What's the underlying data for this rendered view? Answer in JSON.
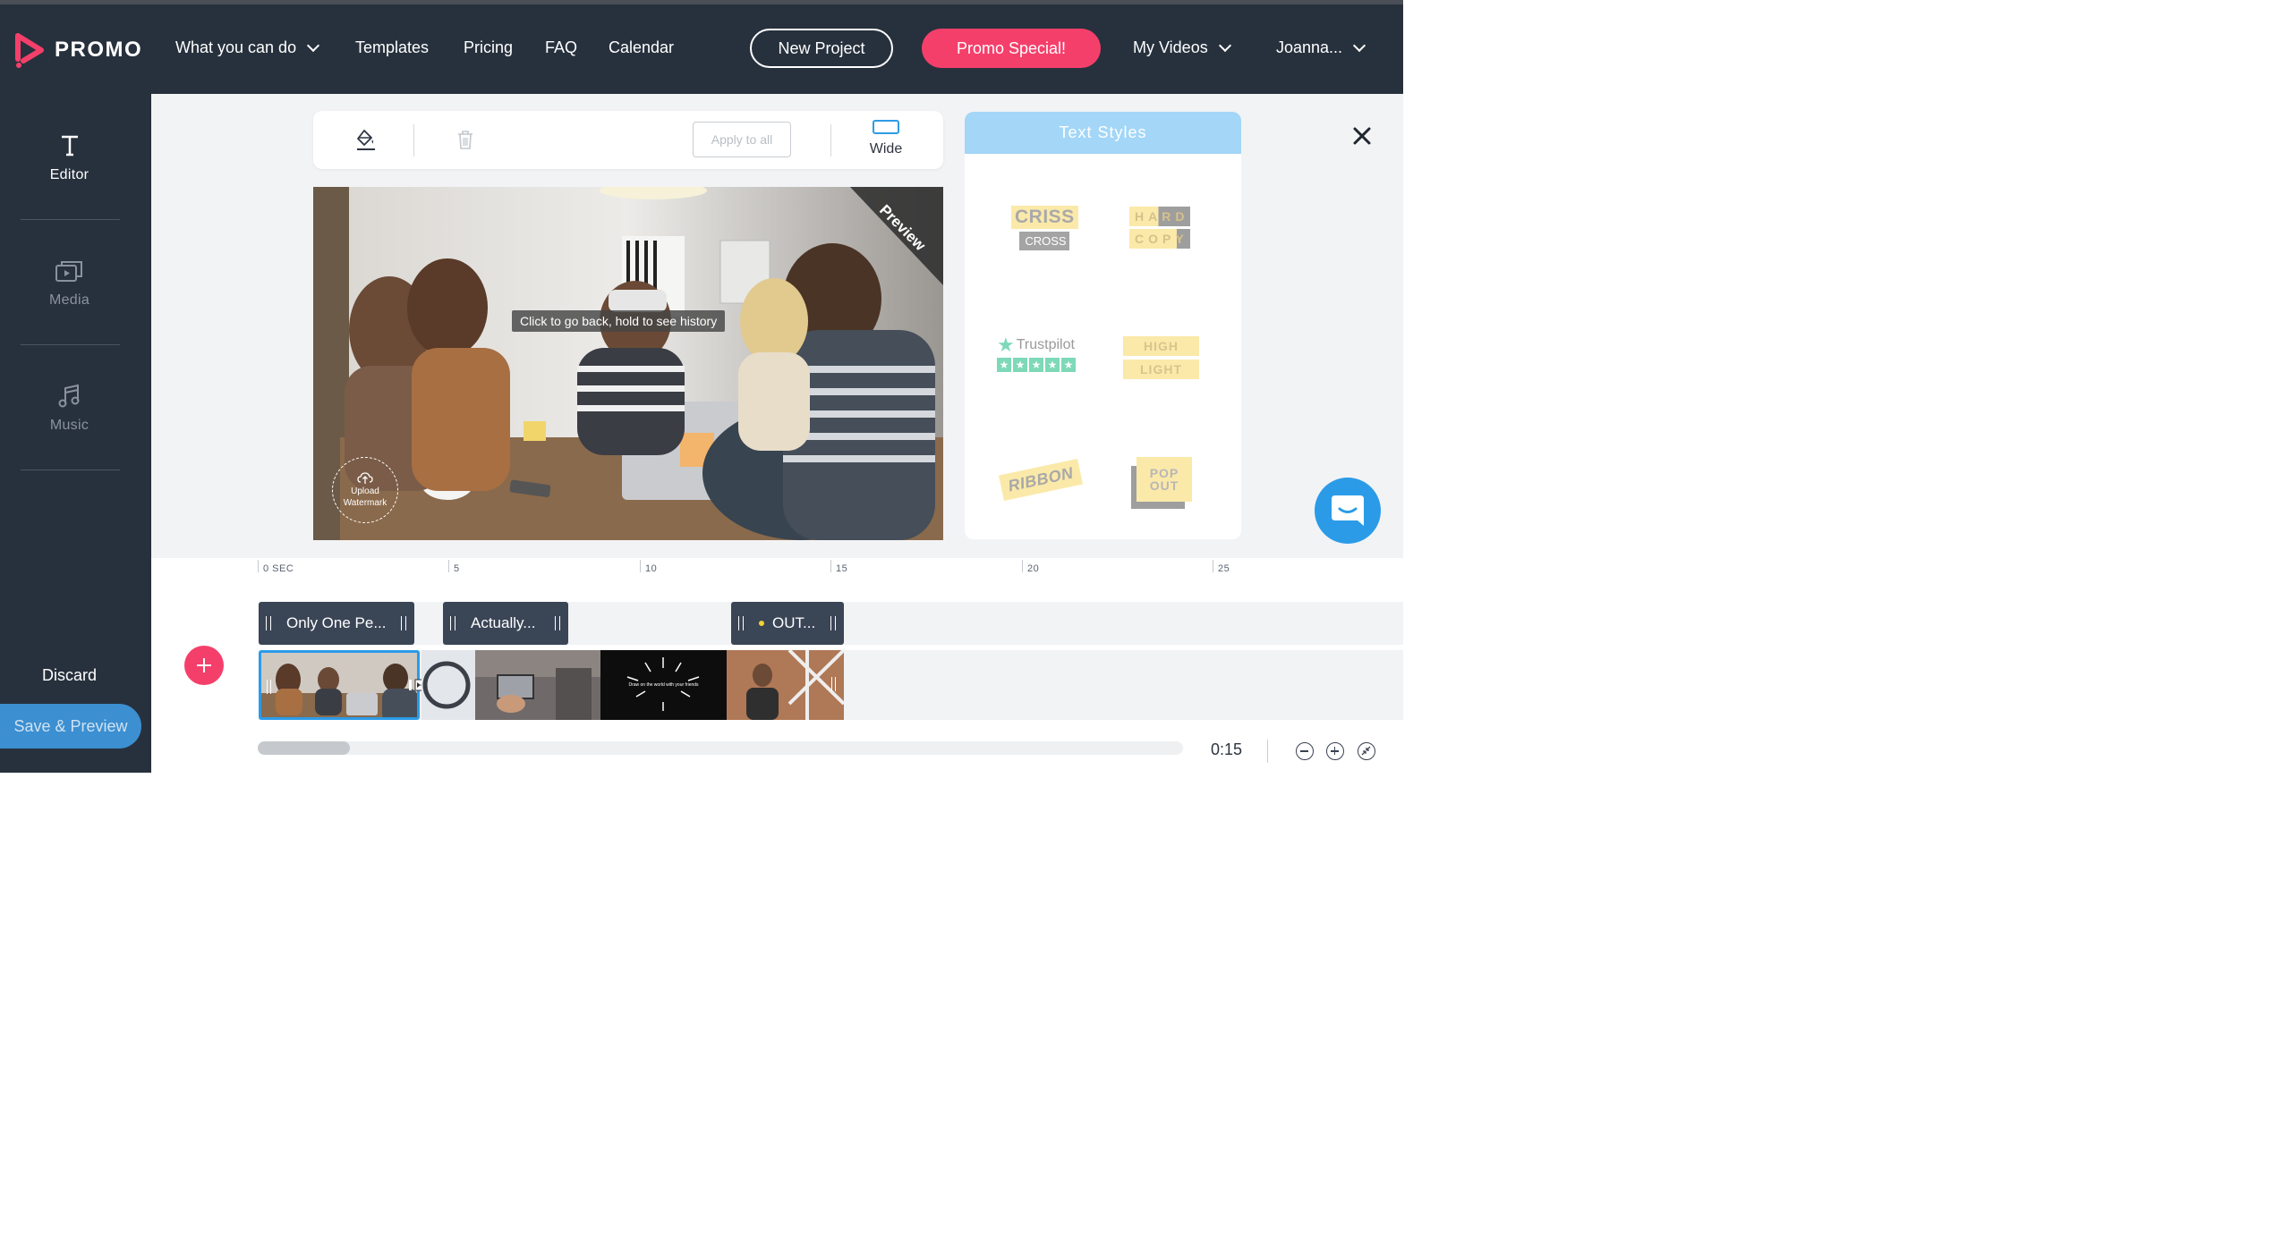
{
  "nav": {
    "brand": "PROMO",
    "links": [
      {
        "label": "What you can do"
      },
      {
        "label": "Templates"
      },
      {
        "label": "Pricing"
      },
      {
        "label": "FAQ"
      },
      {
        "label": "Calendar"
      }
    ],
    "new_project": "New Project",
    "promo_special": "Promo Special!",
    "my_videos": "My Videos",
    "user": "Joanna..."
  },
  "sidebar": {
    "items": [
      {
        "label": "Editor",
        "icon": "text-icon",
        "active": true
      },
      {
        "label": "Media",
        "icon": "media-icon",
        "active": false
      },
      {
        "label": "Music",
        "icon": "music-icon",
        "active": false
      }
    ],
    "discard": "Discard",
    "save_preview": "Save & Preview"
  },
  "toolbar": {
    "apply_all": "Apply to all",
    "format": "Wide"
  },
  "preview": {
    "tooltip": "Click to go back, hold to see history",
    "watermark_line1": "Upload",
    "watermark_line2": "Watermark",
    "corner_tag": "Preview"
  },
  "text_styles": {
    "title": "Text Styles",
    "items": [
      {
        "name": "criss-cross",
        "lines": [
          "CRISS",
          "CROSS"
        ]
      },
      {
        "name": "hard-copy",
        "lines": [
          "HARD",
          "COPY"
        ]
      },
      {
        "name": "trustpilot",
        "lines": [
          "Trustpilot"
        ]
      },
      {
        "name": "highlight",
        "lines": [
          "HIGH",
          "LIGHT"
        ]
      },
      {
        "name": "ribbon",
        "lines": [
          "RIBBON"
        ]
      },
      {
        "name": "pop-out",
        "lines": [
          "POP",
          "OUT"
        ]
      }
    ]
  },
  "timeline": {
    "ruler": [
      "0 SEC",
      "5",
      "10",
      "15",
      "20",
      "25"
    ],
    "text_clips": [
      "Only One Pe...",
      "Actually...",
      "OUT..."
    ],
    "video_clip_caption": "Draw on the world with your friends",
    "duration": "0:15"
  },
  "colors": {
    "nav_bg": "#27313d",
    "accent_pink": "#f53f6b",
    "accent_blue": "#2b9be8",
    "save_blue": "#3c8fd0",
    "styles_header": "#a3d6f7",
    "clip_bg": "#3a4556"
  }
}
